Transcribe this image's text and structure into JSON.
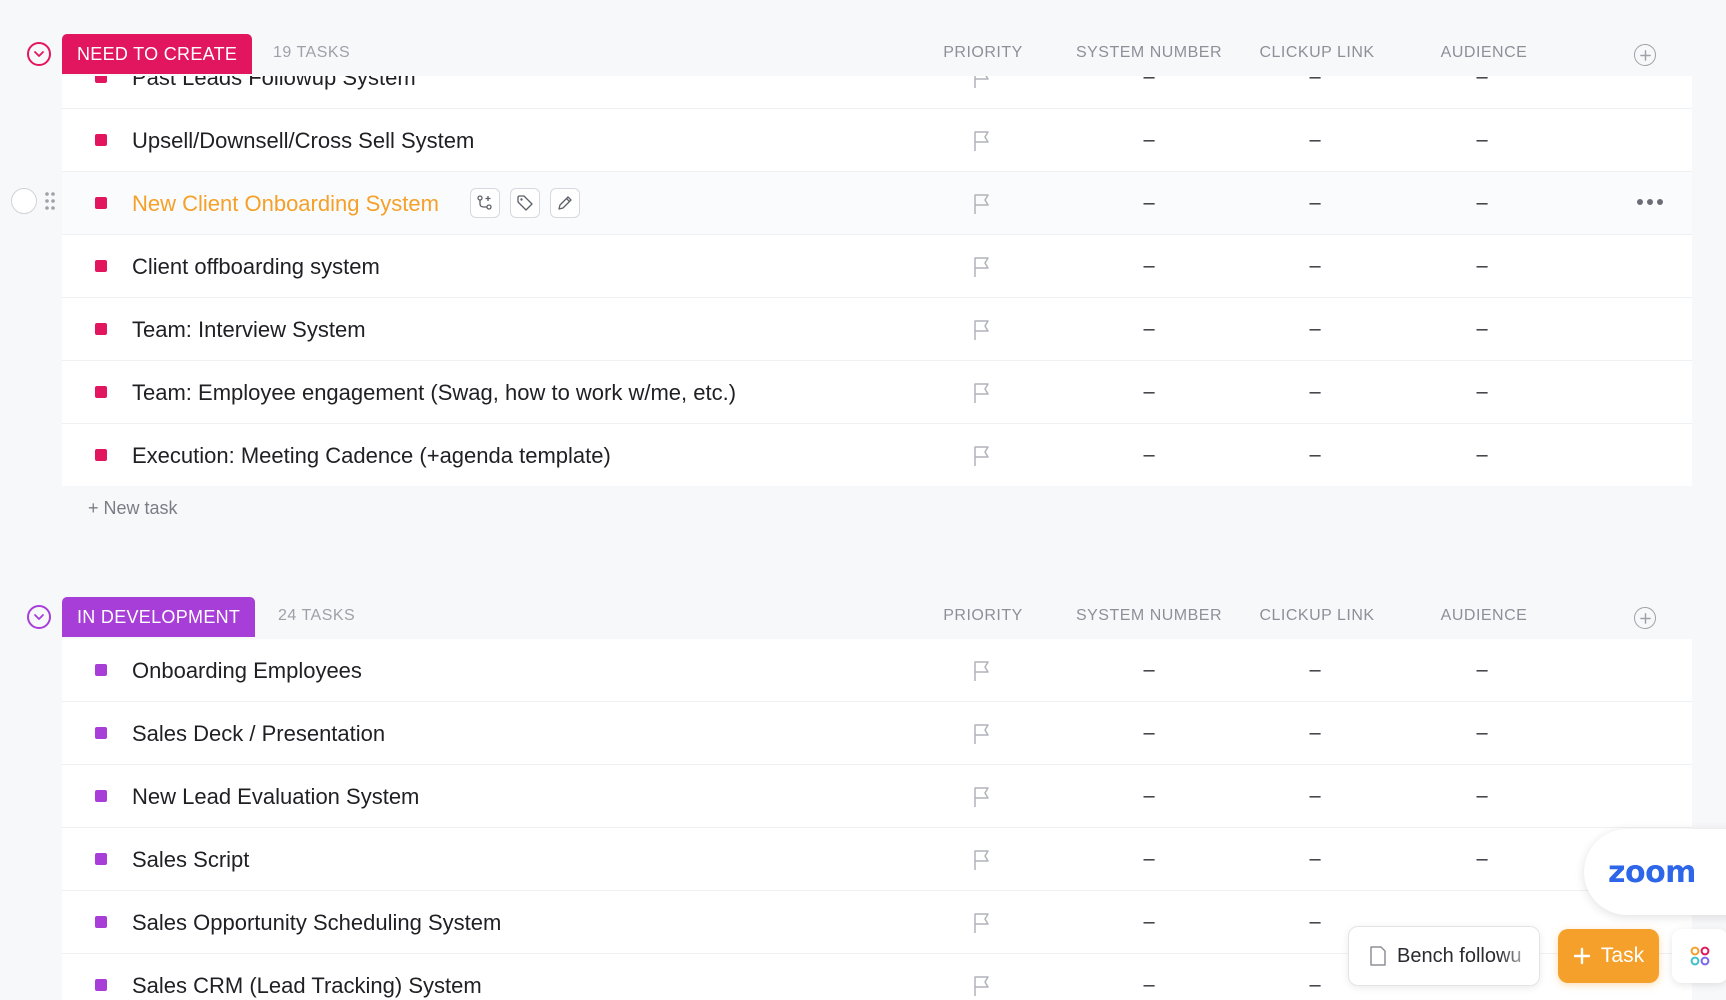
{
  "columns": {
    "priority": "PRIORITY",
    "system_number": "SYSTEM NUMBER",
    "clickup_link": "CLICKUP LINK",
    "audience": "AUDIENCE"
  },
  "empty_value": "–",
  "groups": [
    {
      "status": "NEED TO CREATE",
      "count": "19 TASKS",
      "color": "#e2165e",
      "new_task": "+ New task",
      "tasks": [
        "Past Leads Followup System",
        "Upsell/Downsell/Cross Sell System",
        "New Client Onboarding System",
        "Client offboarding system",
        "Team: Interview System",
        "Team: Employee engagement (Swag, how to work w/me, etc.)",
        "Execution: Meeting Cadence (+agenda template)"
      ]
    },
    {
      "status": "IN DEVELOPMENT",
      "count": "24 TASKS",
      "color": "#a83ed8",
      "tasks": [
        "Onboarding Employees",
        "Sales Deck / Presentation",
        "New Lead Evaluation System",
        "Sales Script",
        "Sales Opportunity Scheduling System",
        "Sales CRM (Lead Tracking) System"
      ]
    }
  ],
  "hovered_task_index": 2,
  "zoom_label": "zoom",
  "bench_chip_label": "Bench followu",
  "task_button_label": "Task"
}
